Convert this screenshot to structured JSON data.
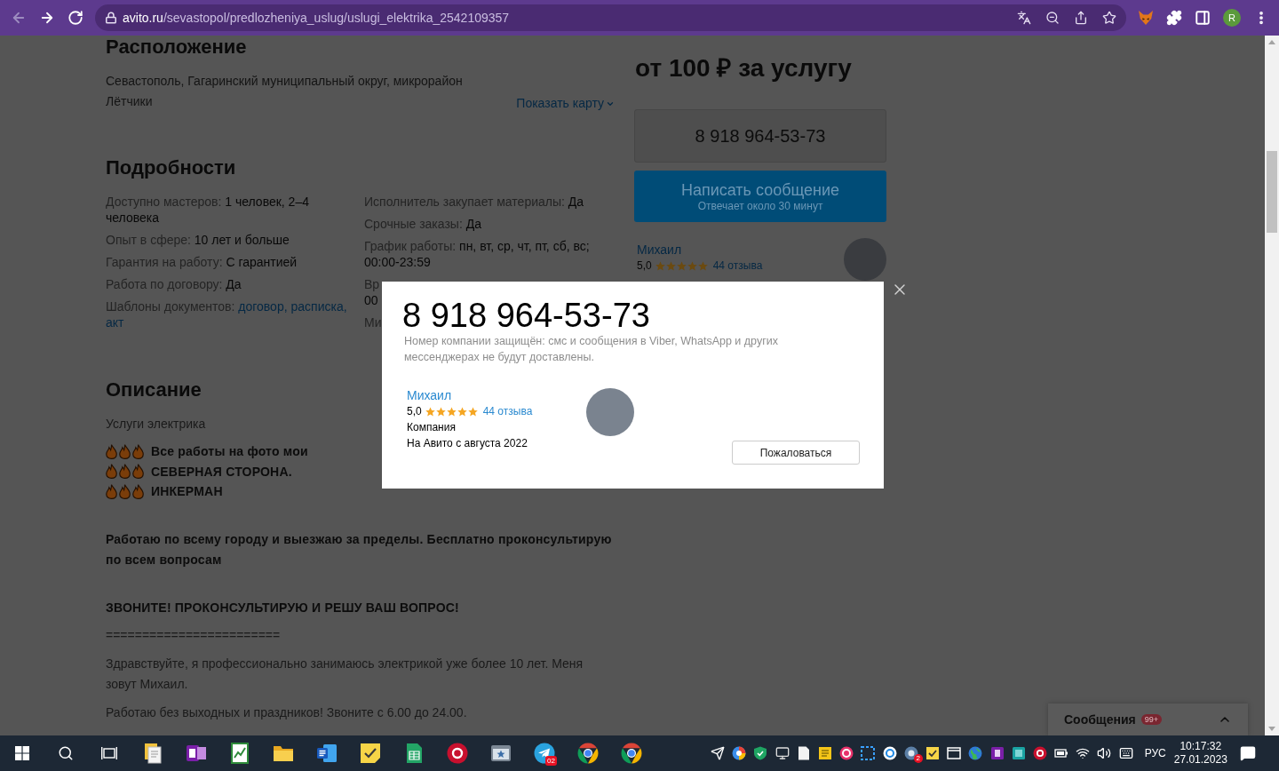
{
  "browser": {
    "nav": [
      {
        "kind": "back",
        "disabled": true
      },
      {
        "kind": "forward",
        "disabled": false
      },
      {
        "kind": "reload",
        "disabled": false
      }
    ],
    "url_host": "avito.ru",
    "url_path": "/sevastopol/predlozheniya_uslug/uslugi_elektrika_2542109357",
    "profile_initial": "R"
  },
  "location": {
    "title": "Расположение",
    "address": "Севастополь, Гагаринский муниципальный округ, микрорайон Лётчики",
    "map_link": "Показать карту"
  },
  "details": {
    "title": "Подробности",
    "columns": [
      [
        {
          "kind": "pair",
          "label": "Доступно мастеров:",
          "value": "1 человек, 2–4 человека"
        },
        {
          "kind": "pair",
          "label": "Опыт в сфере:",
          "value": "10 лет и больше"
        },
        {
          "kind": "pair",
          "label": "Гарантия на работу:",
          "value": "С гарантией"
        },
        {
          "kind": "pair",
          "label": "Работа по договору:",
          "value": "Да"
        },
        {
          "kind": "links",
          "label": "Шаблоны документов:",
          "links": [
            "договор",
            "расписка",
            "акт"
          ],
          "separator": ", "
        }
      ],
      [
        {
          "kind": "pair",
          "label": "Исполнитель закупает материалы:",
          "value": "Да"
        },
        {
          "kind": "pair",
          "label": "Срочные заказы:",
          "value": "Да"
        },
        {
          "kind": "pair",
          "label": "График работы:",
          "value": "пн, вт, ср, чт, пт, сб, вс; 00:00-23:59"
        },
        {
          "kind": "cut",
          "label": "Вр",
          "value": "00"
        },
        {
          "kind": "cut",
          "label": "Ми"
        }
      ]
    ]
  },
  "description": {
    "title": "Описание",
    "blocks": [
      {
        "kind": "plain",
        "text": "Услуги электрика"
      },
      {
        "kind": "flames",
        "text": "Все работы на фото мои"
      },
      {
        "kind": "flames",
        "text": "СЕВЕРНАЯ СТОРОНА."
      },
      {
        "kind": "flames",
        "text": "ИНКЕРМАН"
      },
      {
        "kind": "bold",
        "text": "Работаю по всему городу и выезжаю за пределы. Бесплатно проконсультирую по всем вопросам"
      },
      {
        "kind": "bold",
        "text": "ЗВОНИТЕ! ПРОКОНСУЛЬТИРУЮ И РЕШУ ВАШ ВОПРОС!"
      },
      {
        "kind": "plain",
        "text": "========================"
      },
      {
        "kind": "plain",
        "text": "Здравствуйте, я профессионально занимаюсь электрикой уже более 10 лет. Меня зовут Михаил."
      },
      {
        "kind": "plain",
        "text": "Работаю без выходных и праздников! Звоните с 6.00 до 24.00."
      }
    ]
  },
  "sidebar": {
    "price": "от 100 ₽ за услугу",
    "phone": "8 918 964-53-73",
    "message_button": {
      "label": "Написать сообщение",
      "note": "Отвечает около 30 минут"
    },
    "seller": {
      "name": "Михаил",
      "rating": "5,0",
      "stars": 5,
      "reviews": "44 отзыва"
    }
  },
  "phone_modal": {
    "phone": "8 918 964-53-73",
    "note": "Номер компании защищён: смс и сообщения в Viber, WhatsApp и других мессенджерах не будут доставлены.",
    "seller": {
      "name": "Михаил",
      "rating": "5,0",
      "stars": 5,
      "reviews": "44 отзыва",
      "type": "Компания",
      "since": "На Авито с августа 2022"
    },
    "report_button": "Пожаловаться"
  },
  "messages_widget": {
    "label": "Сообщения",
    "badge": "99+",
    "expanded": false
  },
  "taskbar": {
    "pinned_badge": "02",
    "tray_badge": "2",
    "language": "РУС",
    "time": "10:17:32",
    "date": "27.01.2023"
  }
}
